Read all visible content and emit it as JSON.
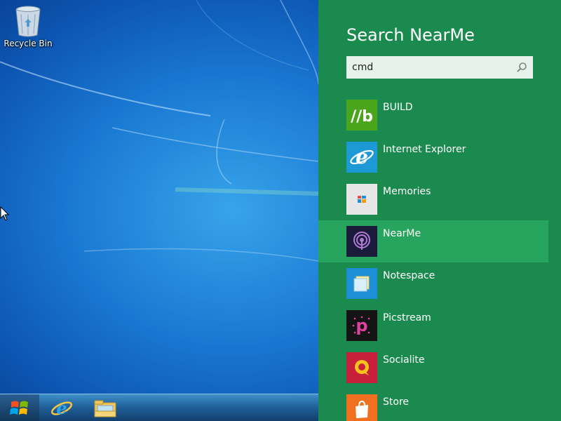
{
  "desktop": {
    "icons": [
      {
        "label": "Recycle Bin",
        "icon": "recycle-bin-icon"
      }
    ]
  },
  "taskbar": {
    "start_icon": "windows-logo-icon",
    "pinned": [
      {
        "name": "Internet Explorer",
        "icon": "internet-explorer-icon"
      },
      {
        "name": "File Explorer",
        "icon": "file-explorer-icon"
      }
    ]
  },
  "search_pane": {
    "title": "Search NearMe",
    "query": "cmd",
    "search_icon": "magnifier-icon",
    "accent_color": "#1b8a4f",
    "selected_color": "#27a55e",
    "results": [
      {
        "label": "BUILD",
        "icon": "build-app-icon",
        "tile_color": "#4aa51c"
      },
      {
        "label": "Internet Explorer",
        "icon": "internet-explorer-icon",
        "tile_color": "#1d9ad6"
      },
      {
        "label": "Memories",
        "icon": "memories-app-icon",
        "tile_color": "#e6e6e6"
      },
      {
        "label": "NearMe",
        "icon": "nearme-app-icon",
        "tile_color": "#1a1a3a",
        "selected": true
      },
      {
        "label": "Notespace",
        "icon": "notespace-app-icon",
        "tile_color": "#1d8fd6"
      },
      {
        "label": "Picstream",
        "icon": "picstream-app-icon",
        "tile_color": "#141414"
      },
      {
        "label": "Socialite",
        "icon": "socialite-app-icon",
        "tile_color": "#c8203a"
      },
      {
        "label": "Store",
        "icon": "store-app-icon",
        "tile_color": "#f07020"
      }
    ]
  }
}
